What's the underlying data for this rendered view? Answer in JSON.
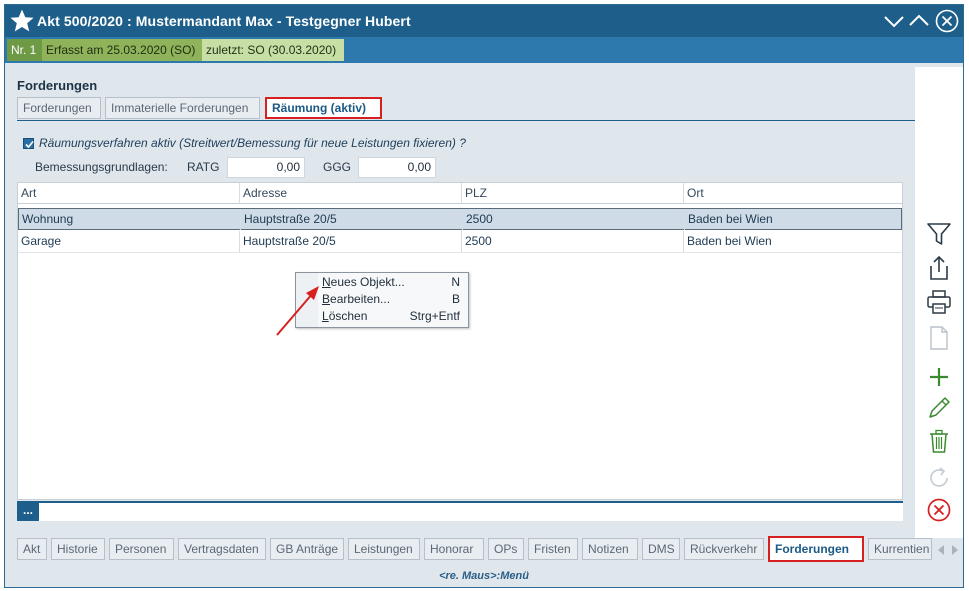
{
  "window": {
    "title": "Akt 500/2020 : Mustermandant Max - Testgegner Hubert"
  },
  "infobar": {
    "nr": "Nr. 1",
    "erfasst": "Erfasst am 25.03.2020 (SO)",
    "zuletzt": "zuletzt: SO (30.03.2020)"
  },
  "section_title": "Forderungen",
  "top_tabs": [
    {
      "label": "Forderungen"
    },
    {
      "label": "Immaterielle Forderungen"
    },
    {
      "label": "Räumung (aktiv)"
    }
  ],
  "raeumung": {
    "checkbox_label": "Räumungsverfahren aktiv (Streitwert/Bemessung für neue Leistungen fixieren) ?",
    "checked": true,
    "bemessung_label": "Bemessungsgrundlagen:",
    "ratg_label": "RATG",
    "ratg_value": "0,00",
    "ggg_label": "GGG",
    "ggg_value": "0,00"
  },
  "table": {
    "columns": [
      "Art",
      "Adresse",
      "PLZ",
      "Ort"
    ],
    "rows": [
      [
        "Wohnung",
        "Hauptstraße 20/5",
        "2500",
        "Baden bei Wien"
      ],
      [
        "Garage",
        "Hauptstraße 20/5",
        "2500",
        "Baden bei Wien"
      ]
    ]
  },
  "footer_button": "...",
  "context_menu": [
    {
      "label": "Neues Objekt...",
      "shortcut": "N"
    },
    {
      "label": "Bearbeiten...",
      "shortcut": "B"
    },
    {
      "label": "Löschen",
      "shortcut": "Strg+Entf"
    }
  ],
  "sidebar_icons": [
    "filter-icon",
    "export-icon",
    "print-icon",
    "document-icon",
    "add-icon",
    "edit-icon",
    "delete-icon",
    "refresh-icon",
    "cancel-icon"
  ],
  "bottom_tabs": [
    {
      "label": "Akt"
    },
    {
      "label": "Historie"
    },
    {
      "label": "Personen"
    },
    {
      "label": "Vertragsdaten"
    },
    {
      "label": "GB Anträge"
    },
    {
      "label": "Leistungen"
    },
    {
      "label": "Honorar"
    },
    {
      "label": "OPs"
    },
    {
      "label": "Fristen"
    },
    {
      "label": "Notizen"
    },
    {
      "label": "DMS"
    },
    {
      "label": "Rückverkehr"
    },
    {
      "label": "Forderungen"
    },
    {
      "label": "Kurrentien"
    }
  ],
  "status": "<re. Maus>:Menü",
  "colors": {
    "titlebar": "#1d5f8a",
    "accent": "#2d78ad",
    "highlight_border": "#d6201f",
    "add_green": "#3a8a2f",
    "cancel_red": "#d6201f"
  }
}
